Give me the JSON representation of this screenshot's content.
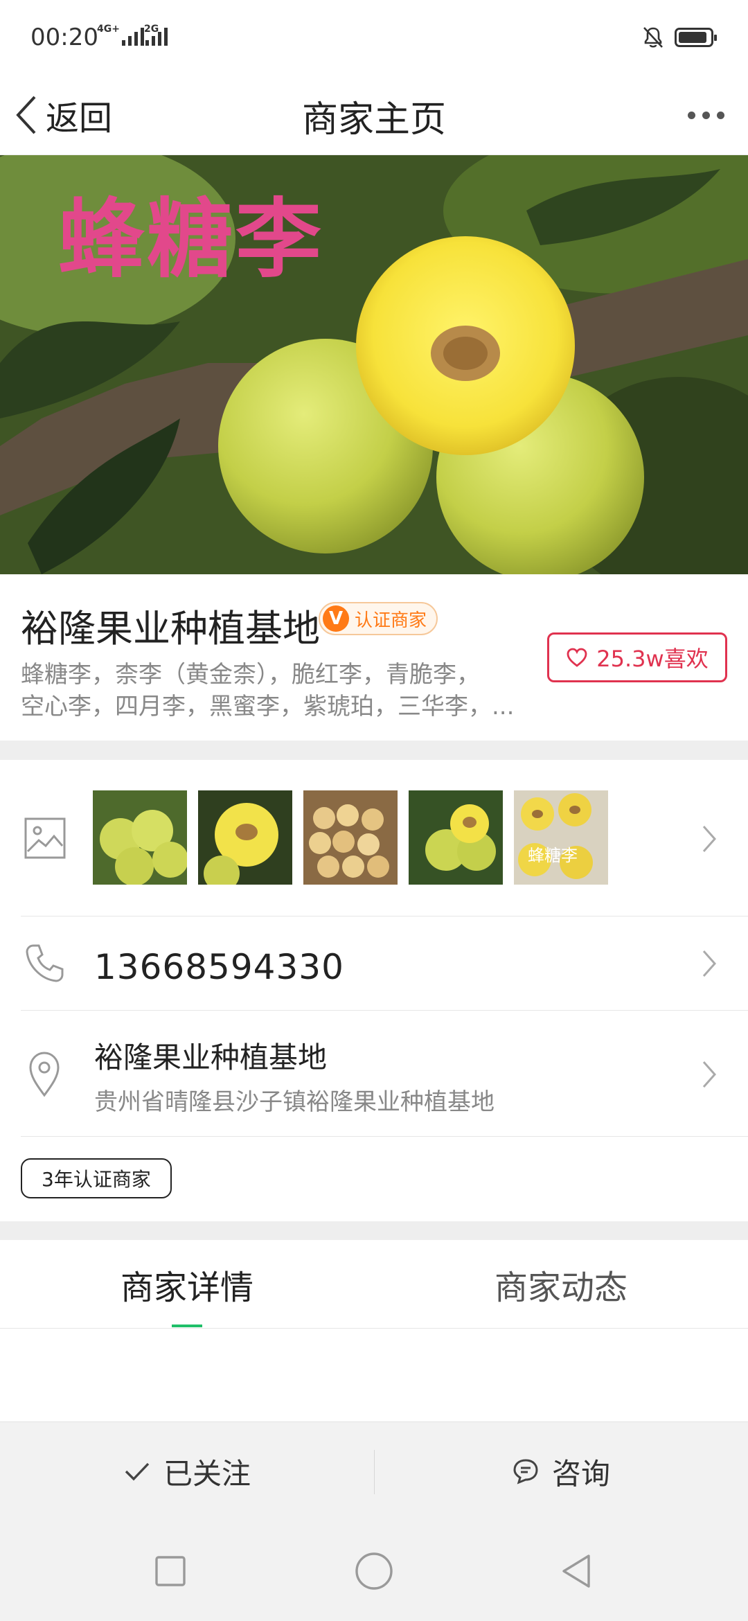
{
  "status_bar": {
    "time": "00:20",
    "network_1": "4G+",
    "network_2": "2G",
    "icons": [
      "signal-icon",
      "mute-bell-icon",
      "battery-icon"
    ],
    "battery_level": 0.9
  },
  "nav": {
    "back_label": "返回",
    "title": "商家主页",
    "more_icon": "more-icon"
  },
  "hero": {
    "caption": "蜂糖李"
  },
  "merchant": {
    "name": "裕隆果业种植基地",
    "verified_mark": "V",
    "verified_label": "认证商家",
    "varieties_line1": "蜂糖李，柰李（黄金柰），脆红李，青脆李，",
    "varieties_line2": "空心李，四月李，黑蜜李，紫琥珀，三华李，...",
    "like_label": "25.3w喜欢"
  },
  "gallery": {
    "icon": "image-icon",
    "thumb_5_text": "蜂糖李"
  },
  "contact": {
    "phone": "13668594330",
    "address_name": "裕隆果业种植基地",
    "address_full": "贵州省晴隆县沙子镇裕隆果业种植基地",
    "cert_badge": "3年认证商家"
  },
  "tabs": [
    {
      "label": "商家详情",
      "active": true
    },
    {
      "label": "商家动态",
      "active": false
    }
  ],
  "actions": {
    "follow_label": "已关注",
    "consult_label": "咨询"
  },
  "colors": {
    "accent_green": "#1fbf69",
    "like_red": "#e0324f",
    "verified_orange": "#ff7a16",
    "caption_pink": "#e2488b"
  }
}
